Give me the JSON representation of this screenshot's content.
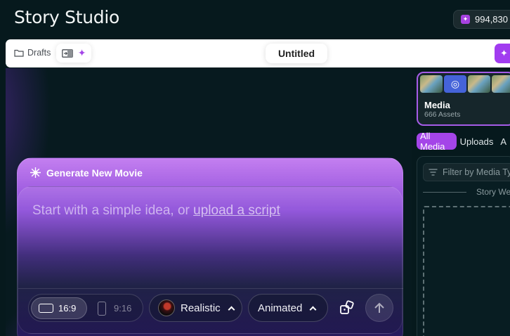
{
  "app": {
    "title": "Story Studio"
  },
  "credits": {
    "amount": "994,830",
    "icon": "sparkle-icon"
  },
  "toolbar": {
    "drafts_label": "Drafts",
    "document_title": "Untitled"
  },
  "generator": {
    "heading": "Generate New Movie",
    "prompt_text": "Start with a simple idea, or ",
    "prompt_link": "upload a script",
    "aspect_options": [
      {
        "label": "16:9",
        "selected": true
      },
      {
        "label": "9:16",
        "selected": false
      }
    ],
    "style_label": "Realistic",
    "animation_label": "Animated"
  },
  "media_panel": {
    "title": "Media",
    "asset_count": "666 Assets",
    "tabs": [
      "All Media",
      "Uploads",
      "A"
    ],
    "active_tab": "All Media",
    "filter_placeholder": "Filter by Media Ty",
    "section_label": "Story We"
  },
  "colors": {
    "accent": "#a445e8",
    "background": "#06191d",
    "toolbar": "#ffffff"
  }
}
